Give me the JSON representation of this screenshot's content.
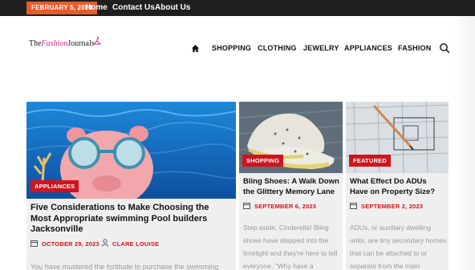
{
  "topbar": {
    "date": "FEBRUARY 5, 2024",
    "links": [
      "Home",
      "Contact Us",
      "About Us"
    ]
  },
  "logo": {
    "the": "The",
    "fashion": "Fashion",
    "journals": "Journals"
  },
  "nav": {
    "items": [
      "SHOPPING",
      "CLOTHING",
      "JEWELRY",
      "APPLIANCES",
      "FASHION"
    ],
    "home_icon": "home-icon",
    "search_icon": "search-icon"
  },
  "articles": [
    {
      "category": "APPLIANCES",
      "title": "Five Considerations to Make Choosing the Most Appropriate swimming Pool builders Jacksonville",
      "date": "OCTOBER 29, 2023",
      "author": "CLARE LOUISE",
      "excerpt": "You have mustered the fortitude to purchase the swimming"
    },
    {
      "category": "SHOPPING",
      "title": "Bling Shoes: A Walk Down the Glittery Memory Lane",
      "date": "SEPTEMBER 6, 2023",
      "excerpt": "Step aside, Cinderella! Bling shoes have stepped into the limelight and they're here to tell everyone, \"Why have a"
    },
    {
      "category": "FEATURED",
      "title": "What Effect Do ADUs Have on Property Size?",
      "date": "SEPTEMBER 2, 2023",
      "excerpt": "ADUs, or auxiliary dwelling units, are tiny secondary homes that can be attached to or separate from the main"
    }
  ],
  "colors": {
    "accent_red": "#d0141e",
    "date_orange": "#e65c2e",
    "logo_pink": "#c8288a",
    "topbar_bg": "#1f1f1f"
  }
}
